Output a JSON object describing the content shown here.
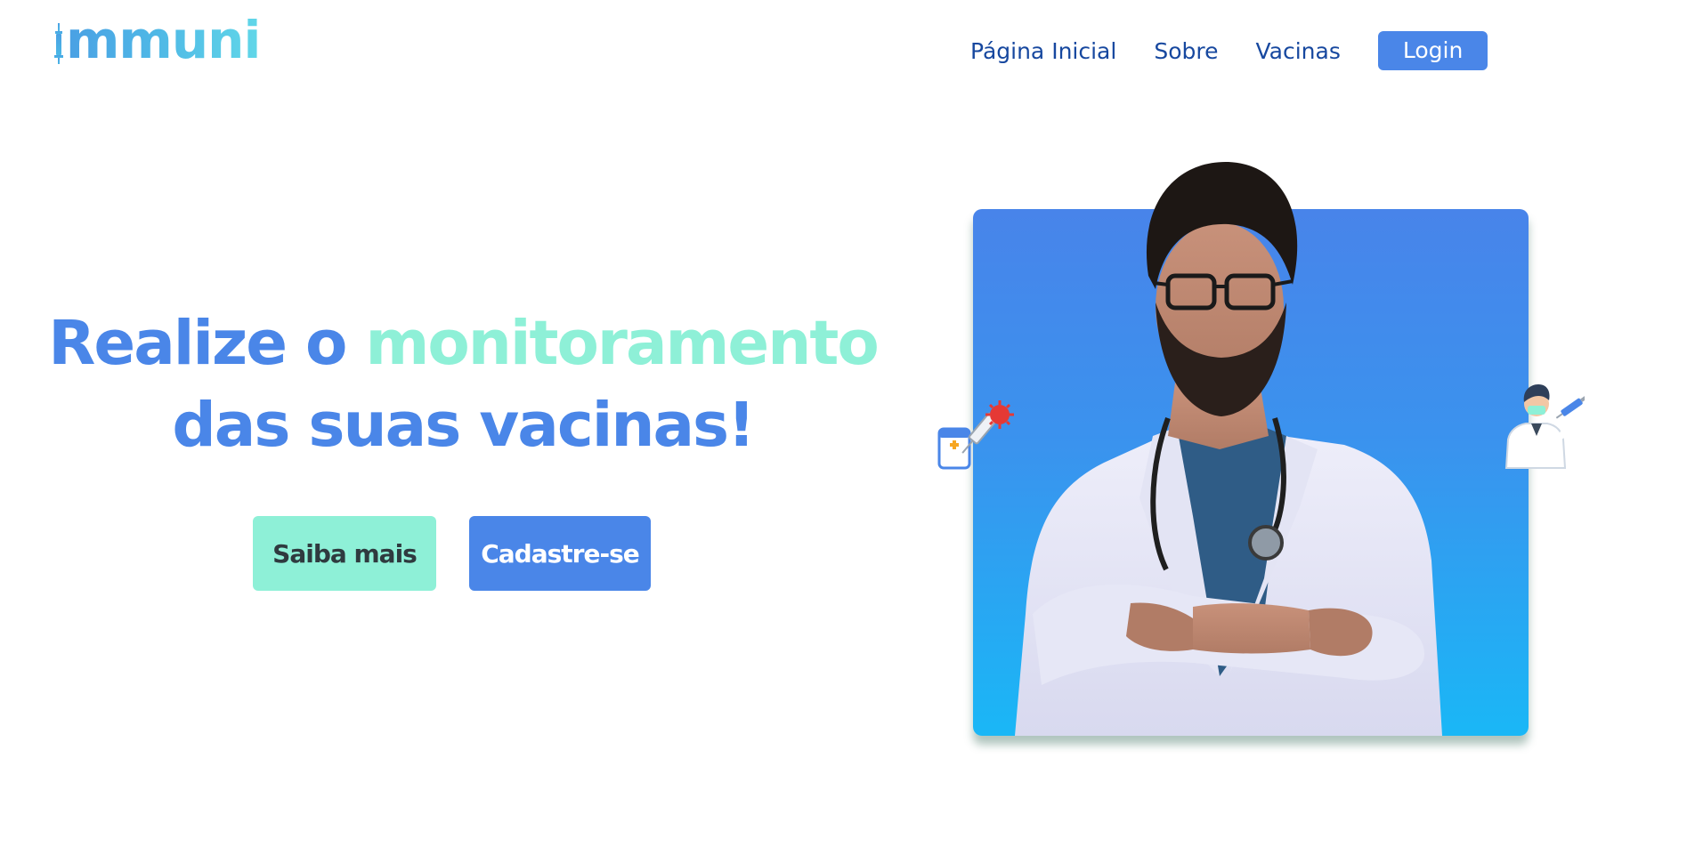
{
  "header": {
    "logo_text": "mmuni",
    "logo_icon": "syringe-icon",
    "nav": [
      {
        "label": "Página Inicial"
      },
      {
        "label": "Sobre"
      },
      {
        "label": "Vacinas"
      }
    ],
    "login_label": "Login"
  },
  "hero": {
    "title_part1": "Realize o ",
    "title_accent": "monitoramento",
    "title_part2": "das suas vacinas!",
    "btn_learn_more": "Saiba mais",
    "btn_signup": "Cadastre-se"
  },
  "illustration": {
    "main": "doctor-photo",
    "left_icon": "vaccine-syringe-virus-icon",
    "right_icon": "doctor-with-syringe-icon"
  },
  "colors": {
    "primary_blue": "#4a86e8",
    "accent_mint": "#8ef0d7",
    "nav_text": "#17489f",
    "dark_text": "#2f3a3f"
  }
}
